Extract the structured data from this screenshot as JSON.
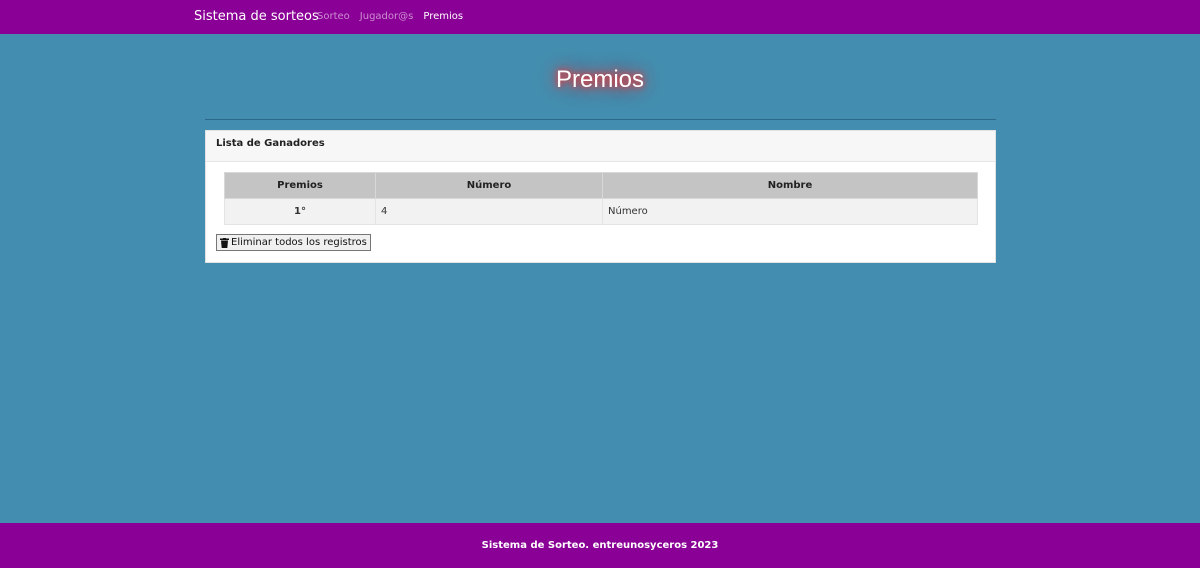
{
  "navbar": {
    "brand": "Sistema de sorteos",
    "links": [
      {
        "label": "Sorteo",
        "active": false
      },
      {
        "label": "Jugador@s",
        "active": false
      },
      {
        "label": "Premios",
        "active": true
      }
    ]
  },
  "page": {
    "title": "Premios"
  },
  "card": {
    "header": "Lista de Ganadores",
    "table": {
      "headers": [
        "Premios",
        "Número",
        "Nombre"
      ],
      "rows": [
        {
          "premio": "1°",
          "numero": "4",
          "nombre": "Número"
        }
      ]
    },
    "delete_button": {
      "icon": "trash-icon",
      "label": "Eliminar todos los registros"
    }
  },
  "footer": {
    "text": "Sistema de Sorteo. entreunosyceros 2023"
  },
  "colors": {
    "navbar_bg": "#8a0096",
    "page_bg": "#438eb0",
    "title_glow": "#ff2a2a",
    "table_header_bg": "#c4c4c4"
  }
}
